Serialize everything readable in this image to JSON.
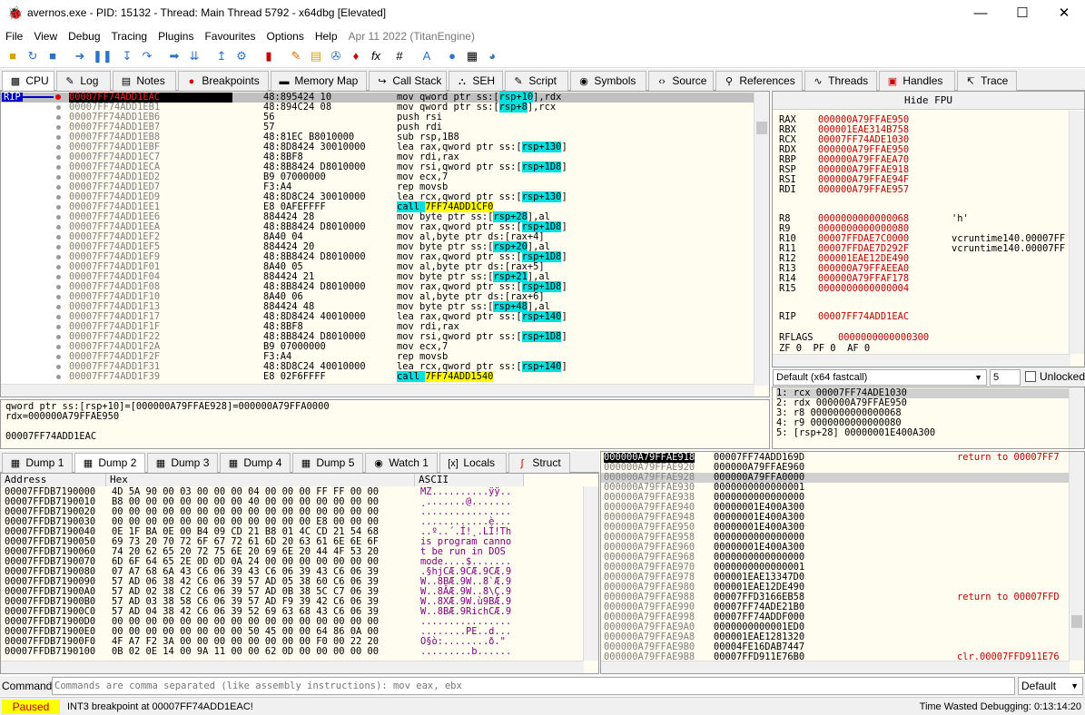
{
  "title": "avernos.exe - PID: 15132 - Thread: Main Thread 5792 - x64dbg [Elevated]",
  "menu": [
    "File",
    "View",
    "Debug",
    "Tracing",
    "Plugins",
    "Favourites",
    "Options",
    "Help"
  ],
  "version": "Apr 11 2022 (TitanEngine)",
  "tabs": [
    "CPU",
    "Log",
    "Notes",
    "Breakpoints",
    "Memory Map",
    "Call Stack",
    "SEH",
    "Script",
    "Symbols",
    "Source",
    "References",
    "Threads",
    "Handles",
    "Trace"
  ],
  "rip_label": "RIP",
  "disasm": [
    {
      "addr": "00007FF74ADD1EAC",
      "bytes": "48:895424 10",
      "ins": [
        "mov qword ptr ss:[",
        "rsp+10",
        "],rdx"
      ]
    },
    {
      "addr": "00007FF74ADD1EB1",
      "bytes": "48:894C24 08",
      "ins": [
        "mov qword ptr ss:[",
        "rsp+8",
        "],rcx"
      ]
    },
    {
      "addr": "00007FF74ADD1EB6",
      "bytes": "56",
      "ins": [
        "push rsi"
      ]
    },
    {
      "addr": "00007FF74ADD1EB7",
      "bytes": "57",
      "ins": [
        "push rdi"
      ]
    },
    {
      "addr": "00007FF74ADD1EB8",
      "bytes": "48:81EC B8010000",
      "ins": [
        "sub rsp,1B8"
      ]
    },
    {
      "addr": "00007FF74ADD1EBF",
      "bytes": "48:8D8424 30010000",
      "ins": [
        "lea rax,qword ptr ss:[",
        "rsp+130",
        "]"
      ]
    },
    {
      "addr": "00007FF74ADD1EC7",
      "bytes": "48:8BF8",
      "ins": [
        "mov rdi,rax"
      ]
    },
    {
      "addr": "00007FF74ADD1ECA",
      "bytes": "48:8B8424 D8010000",
      "ins": [
        "mov rsi,qword ptr ss:[",
        "rsp+1D8",
        "]"
      ]
    },
    {
      "addr": "00007FF74ADD1ED2",
      "bytes": "B9 07000000",
      "ins": [
        "mov ecx,7"
      ]
    },
    {
      "addr": "00007FF74ADD1ED7",
      "bytes": "F3:A4",
      "ins": [
        "rep movsb"
      ]
    },
    {
      "addr": "00007FF74ADD1ED9",
      "bytes": "48:8D8C24 30010000",
      "ins": [
        "lea rcx,qword ptr ss:[",
        "rsp+130",
        "]"
      ]
    },
    {
      "addr": "00007FF74ADD1EE1",
      "bytes": "E8 0AFEFFFF",
      "ins": [
        "call ",
        "7FF74ADD1CF0"
      ],
      "call": true
    },
    {
      "addr": "00007FF74ADD1EE6",
      "bytes": "884424 28",
      "ins": [
        "mov byte ptr ss:[",
        "rsp+28",
        "],al"
      ]
    },
    {
      "addr": "00007FF74ADD1EEA",
      "bytes": "48:8B8424 D8010000",
      "ins": [
        "mov rax,qword ptr ss:[",
        "rsp+1D8",
        "]"
      ]
    },
    {
      "addr": "00007FF74ADD1EF2",
      "bytes": "8A40 04",
      "ins": [
        "mov al,byte ptr ds:[rax+4]"
      ]
    },
    {
      "addr": "00007FF74ADD1EF5",
      "bytes": "884424 20",
      "ins": [
        "mov byte ptr ss:[",
        "rsp+20",
        "],al"
      ]
    },
    {
      "addr": "00007FF74ADD1EF9",
      "bytes": "48:8B8424 D8010000",
      "ins": [
        "mov rax,qword ptr ss:[",
        "rsp+1D8",
        "]"
      ]
    },
    {
      "addr": "00007FF74ADD1F01",
      "bytes": "8A40 05",
      "ins": [
        "mov al,byte ptr ds:[rax+5]"
      ]
    },
    {
      "addr": "00007FF74ADD1F04",
      "bytes": "884424 21",
      "ins": [
        "mov byte ptr ss:[",
        "rsp+21",
        "],al"
      ]
    },
    {
      "addr": "00007FF74ADD1F08",
      "bytes": "48:8B8424 D8010000",
      "ins": [
        "mov rax,qword ptr ss:[",
        "rsp+1D8",
        "]"
      ]
    },
    {
      "addr": "00007FF74ADD1F10",
      "bytes": "8A40 06",
      "ins": [
        "mov al,byte ptr ds:[rax+6]"
      ]
    },
    {
      "addr": "00007FF74ADD1F13",
      "bytes": "884424 48",
      "ins": [
        "mov byte ptr ss:[",
        "rsp+48",
        "],al"
      ]
    },
    {
      "addr": "00007FF74ADD1F17",
      "bytes": "48:8D8424 40010000",
      "ins": [
        "lea rax,qword ptr ss:[",
        "rsp+140",
        "]"
      ]
    },
    {
      "addr": "00007FF74ADD1F1F",
      "bytes": "48:8BF8",
      "ins": [
        "mov rdi,rax"
      ]
    },
    {
      "addr": "00007FF74ADD1F22",
      "bytes": "48:8B8424 D8010000",
      "ins": [
        "mov rsi,qword ptr ss:[",
        "rsp+1D8",
        "]"
      ]
    },
    {
      "addr": "00007FF74ADD1F2A",
      "bytes": "B9 07000000",
      "ins": [
        "mov ecx,7"
      ]
    },
    {
      "addr": "00007FF74ADD1F2F",
      "bytes": "F3:A4",
      "ins": [
        "rep movsb"
      ]
    },
    {
      "addr": "00007FF74ADD1F31",
      "bytes": "48:8D8C24 40010000",
      "ins": [
        "lea rcx,qword ptr ss:[",
        "rsp+140",
        "]"
      ]
    },
    {
      "addr": "00007FF74ADD1F39",
      "bytes": "E8 02F6FFFF",
      "ins": [
        "call ",
        "7FF74ADD1540"
      ],
      "call": true
    }
  ],
  "info": {
    "line1": "qword ptr ss:[rsp+10]=[000000A79FFAE928]=000000A79FFA0000",
    "line2": "rdx=000000A79FFAE950",
    "line3": "00007FF74ADD1EAC"
  },
  "fpu_header": "Hide FPU",
  "regs1": [
    {
      "n": "RAX",
      "v": "000000A79FFAE950",
      "c": ""
    },
    {
      "n": "RBX",
      "v": "000001EAE314B758",
      "c": ""
    },
    {
      "n": "RCX",
      "v": "00007FF74ADE1030",
      "c": ""
    },
    {
      "n": "RDX",
      "v": "000000A79FFAE950",
      "c": ""
    },
    {
      "n": "RBP",
      "v": "000000A79FFAEA70",
      "c": ""
    },
    {
      "n": "RSP",
      "v": "000000A79FFAE918",
      "c": ""
    },
    {
      "n": "RSI",
      "v": "000000A79FFAE94F",
      "c": ""
    },
    {
      "n": "RDI",
      "v": "000000A79FFAE957",
      "c": ""
    }
  ],
  "regs2": [
    {
      "n": "R8",
      "v": "0000000000000068",
      "c": "'h'"
    },
    {
      "n": "R9",
      "v": "0000000000000080",
      "c": ""
    },
    {
      "n": "R10",
      "v": "00007FFDAE7C0000",
      "c": "vcruntime140.00007FF"
    },
    {
      "n": "R11",
      "v": "00007FFDAE7D292F",
      "c": "vcruntime140.00007FF"
    },
    {
      "n": "R12",
      "v": "000001EAE12DE490",
      "c": ""
    },
    {
      "n": "R13",
      "v": "000000A79FFAEEA0",
      "c": ""
    },
    {
      "n": "R14",
      "v": "000000A79FFAF178",
      "c": ""
    },
    {
      "n": "R15",
      "v": "0000000000000004",
      "c": ""
    }
  ],
  "rip": {
    "n": "RIP",
    "v": "00007FF74ADD1EAC"
  },
  "rflags": {
    "n": "RFLAGS",
    "v": "0000000000000300"
  },
  "flags_line": "ZF 0  PF 0  AF 0",
  "callconv": {
    "value": "Default (x64 fastcall)",
    "count": "5",
    "unlocked": "Unlocked"
  },
  "args": [
    "1: rcx 00007FF74ADE1030",
    "2: rdx 000000A79FFAE950",
    "3: r8 0000000000000068",
    "4: r9 0000000000000080",
    "5: [rsp+28] 00000001E400A300"
  ],
  "dump_tabs": [
    "Dump 1",
    "Dump 2",
    "Dump 3",
    "Dump 4",
    "Dump 5",
    "Watch 1",
    "Locals",
    "Struct"
  ],
  "dump_cols": {
    "addr": "Address",
    "hex": "Hex",
    "ascii": "ASCII"
  },
  "dump": [
    {
      "a": "00007FFDB7190000",
      "h": "4D 5A 90 00 03 00 00 00 04 00 00 00 FF FF 00 00",
      "x": "MZ..........ÿÿ.."
    },
    {
      "a": "00007FFDB7190010",
      "h": "B8 00 00 00 00 00 00 00 40 00 00 00 00 00 00 00",
      "x": "¸.......@......."
    },
    {
      "a": "00007FFDB7190020",
      "h": "00 00 00 00 00 00 00 00 00 00 00 00 00 00 00 00",
      "x": "................"
    },
    {
      "a": "00007FFDB7190030",
      "h": "00 00 00 00 00 00 00 00 00 00 00 00 E8 00 00 00",
      "x": "............è..."
    },
    {
      "a": "00007FFDB7190040",
      "h": "0E 1F BA 0E 00 B4 09 CD 21 B8 01 4C CD 21 54 68",
      "x": "..º..´.Í!¸.LÍ!Th"
    },
    {
      "a": "00007FFDB7190050",
      "h": "69 73 20 70 72 6F 67 72 61 6D 20 63 61 6E 6E 6F",
      "x": "is program canno"
    },
    {
      "a": "00007FFDB7190060",
      "h": "74 20 62 65 20 72 75 6E 20 69 6E 20 44 4F 53 20",
      "x": "t be run in DOS "
    },
    {
      "a": "00007FFDB7190070",
      "h": "6D 6F 64 65 2E 0D 0D 0A 24 00 00 00 00 00 00 00",
      "x": "mode....$......."
    },
    {
      "a": "00007FFDB7190080",
      "h": "07 A7 68 6A 43 C6 06 39 43 C6 06 39 43 C6 06 39",
      "x": ".§hjCÆ.9CÆ.9CÆ.9"
    },
    {
      "a": "00007FFDB7190090",
      "h": "57 AD 06 38 42 C6 06 39 57 AD 05 38 60 C6 06 39",
      "x": "W..8BÆ.9W..8`Æ.9"
    },
    {
      "a": "00007FFDB71900A0",
      "h": "57 AD 02 38 C2 C6 06 39 57 AD 0B 38 5C C7 06 39",
      "x": "W..8ÂÆ.9W..8\\Ç.9"
    },
    {
      "a": "00007FFDB71900B0",
      "h": "57 AD 03 38 58 C6 06 39 57 AD F9 39 42 C6 06 39",
      "x": "W..8XÆ.9W.ù9BÆ.9"
    },
    {
      "a": "00007FFDB71900C0",
      "h": "57 AD 04 38 42 C6 06 39 52 69 63 68 43 C6 06 39",
      "x": "W..8BÆ.9RichCÆ.9"
    },
    {
      "a": "00007FFDB71900D0",
      "h": "00 00 00 00 00 00 00 00 00 00 00 00 00 00 00 00",
      "x": "................"
    },
    {
      "a": "00007FFDB71900E0",
      "h": "00 00 00 00 00 00 00 00 50 45 00 00 64 86 0A 00",
      "x": "........PE..d..."
    },
    {
      "a": "00007FFDB71900F0",
      "h": "4F A7 F2 3A 00 00 00 00 00 00 00 00 F0 00 22 20",
      "x": "O§ò:........ð.\" "
    },
    {
      "a": "00007FFDB7190100",
      "h": "0B 02 0E 14 00 9A 11 00 00 62 0D 00 00 00 00 00",
      "x": ".........b......"
    }
  ],
  "stack": [
    {
      "a": "000000A79FFAE918",
      "v": "00007FF74ADD169D",
      "c": "return to 00007FF7"
    },
    {
      "a": "000000A79FFAE920",
      "v": "000000A79FFAE960",
      "c": ""
    },
    {
      "a": "000000A79FFAE928",
      "v": "000000A79FFA0000",
      "c": ""
    },
    {
      "a": "000000A79FFAE930",
      "v": "0000000000000001",
      "c": ""
    },
    {
      "a": "000000A79FFAE938",
      "v": "0000000000000000",
      "c": ""
    },
    {
      "a": "000000A79FFAE940",
      "v": "00000001E400A300",
      "c": ""
    },
    {
      "a": "000000A79FFAE948",
      "v": "00000001E400A300",
      "c": ""
    },
    {
      "a": "000000A79FFAE950",
      "v": "00000001E400A300",
      "c": ""
    },
    {
      "a": "000000A79FFAE958",
      "v": "0000000000000000",
      "c": ""
    },
    {
      "a": "000000A79FFAE960",
      "v": "00000001E400A300",
      "c": ""
    },
    {
      "a": "000000A79FFAE968",
      "v": "0000000000000000",
      "c": ""
    },
    {
      "a": "000000A79FFAE970",
      "v": "0000000000000001",
      "c": ""
    },
    {
      "a": "000000A79FFAE978",
      "v": "000001EAE13347D0",
      "c": ""
    },
    {
      "a": "000000A79FFAE980",
      "v": "000001EAE12DE490",
      "c": ""
    },
    {
      "a": "000000A79FFAE988",
      "v": "00007FFD3166EB58",
      "c": "return to 00007FFD"
    },
    {
      "a": "000000A79FFAE990",
      "v": "00007FF74ADE21B0",
      "c": ""
    },
    {
      "a": "000000A79FFAE998",
      "v": "00007FF74ADDF000",
      "c": ""
    },
    {
      "a": "000000A79FFAE9A0",
      "v": "0000000000001ED0",
      "c": ""
    },
    {
      "a": "000000A79FFAE9A8",
      "v": "000001EAE1281320",
      "c": ""
    },
    {
      "a": "000000A79FFAE9B0",
      "v": "00004FE16DAB7447",
      "c": ""
    },
    {
      "a": "000000A79FFAE9B8",
      "v": "00007FFD911E76B0",
      "c": "clr.00007FFD911E76"
    }
  ],
  "command": {
    "label": "Command:",
    "placeholder": "Commands are comma separated (like assembly instructions): mov eax, ebx",
    "mode": "Default"
  },
  "status": {
    "state": "Paused",
    "message": "INT3 breakpoint at 00007FF74ADD1EAC!",
    "wasted": "Time Wasted Debugging: 0:13:14:20"
  },
  "colors": {
    "accent": "#ffff00",
    "highlight": "#00e0e0",
    "reg": "#c00000",
    "paused": "#ffff00"
  }
}
